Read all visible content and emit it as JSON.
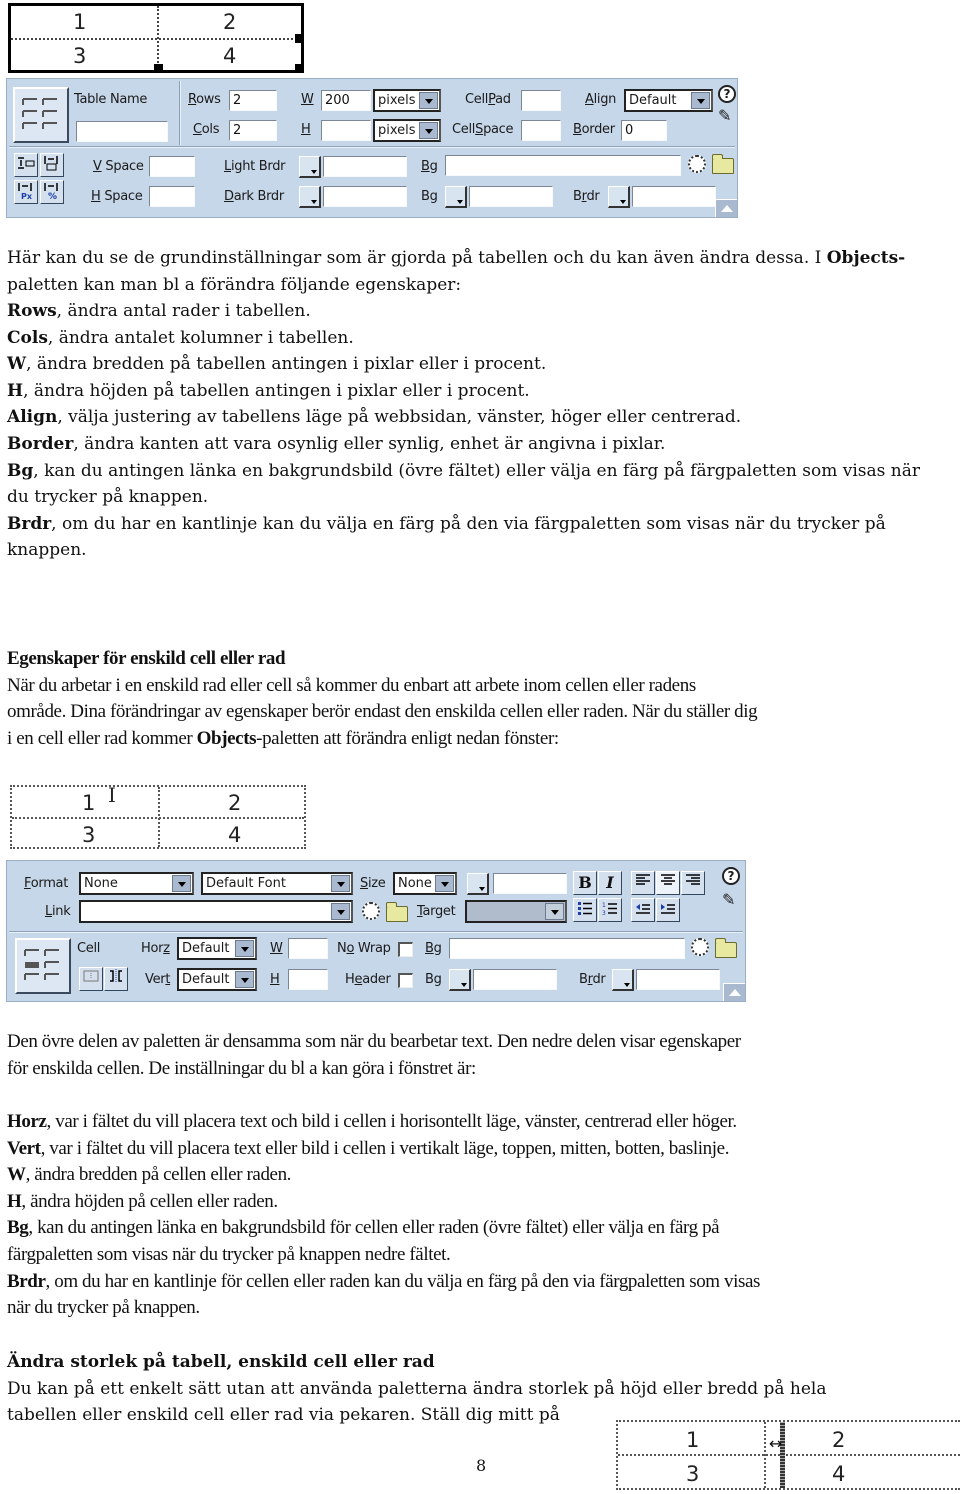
{
  "table_diagram_1": {
    "cells": [
      "1",
      "2",
      "3",
      "4"
    ]
  },
  "table_palette": {
    "table_name_label": "Table Name",
    "table_name_value": "",
    "rows_label": "Rows",
    "rows_value": "2",
    "cols_label": "Cols",
    "cols_value": "2",
    "w_label": "W",
    "w_value": "200",
    "w_unit": "pixels",
    "h_label": "H",
    "h_value": "",
    "h_unit": "pixels",
    "cellpad_label": "CellPad",
    "cellpad_value": "",
    "cellspace_label": "CellSpace",
    "cellspace_value": "",
    "align_label": "Align",
    "align_value": "Default",
    "border_label": "Border",
    "border_value": "0",
    "vspace_label": "V Space",
    "vspace_value": "",
    "hspace_label": "H Space",
    "hspace_value": "",
    "light_brdr_label": "Light Brdr",
    "light_brdr_value": "",
    "dark_brdr_label": "Dark Brdr",
    "dark_brdr_value": "",
    "bg_image_label": "Bg",
    "bg_image_value": "",
    "bg_color_label": "Bg",
    "bg_color_value": "",
    "brdr_label": "Brdr",
    "brdr_value": "",
    "help_glyph": "?",
    "icons": [
      "table-icon",
      "clear-row-heights-icon",
      "clear-col-widths-icon",
      "convert-widths-to-pixels-icon",
      "convert-widths-to-percent-icon",
      "help-icon",
      "quick-tag-editor-icon",
      "point-to-file-icon",
      "folder-icon",
      "collapse-icon"
    ]
  },
  "section1": {
    "intro_line1_prefix": "Här kan du se de grundinställningar som är gjorda på tabellen och du kan även ändra dessa. I ",
    "intro_line1_bold": "Objects-",
    "intro_line2": "paletten kan man bl a förändra följande egenskaper:",
    "items": [
      {
        "term": "Rows",
        "desc": ", ändra antal rader i tabellen."
      },
      {
        "term": "Cols",
        "desc": ", ändra antalet kolumner i tabellen."
      },
      {
        "term": "W",
        "desc": ", ändra bredden på tabellen antingen i pixlar eller i procent."
      },
      {
        "term": "H",
        "desc": ", ändra höjden på tabellen antingen i pixlar eller i procent."
      },
      {
        "term": "Align",
        "desc": ", välja justering av tabellens läge på webbsidan, vänster, höger eller centrerad."
      },
      {
        "term": "Border",
        "desc": ", ändra kanten att vara osynlig eller synlig, enhet är angivna i pixlar."
      },
      {
        "term": "Bg",
        "desc": ", kan du antingen länka en bakgrundsbild (övre fältet) eller välja en färg på färgpaletten som visas när",
        "desc2": "du trycker på knappen."
      },
      {
        "term": "Brdr",
        "desc": ", om du har en kantlinje kan du välja en färg på den via färgpaletten som visas när du trycker på",
        "desc2": "knappen."
      }
    ]
  },
  "section2": {
    "heading": "Egenskaper för enskild cell eller rad",
    "para_line1": "När du arbetar i en enskild rad eller cell så kommer du enbart att arbete inom cellen eller radens",
    "para_line2": "område. Dina förändringar av egenskaper berör endast den enskilda cellen eller raden. När du ställer dig",
    "para_line3_prefix": "i en cell eller rad kommer ",
    "para_line3_bold": "Objects",
    "para_line3_suffix": "-paletten att förändra enligt nedan fönster:"
  },
  "table_diagram_2": {
    "cells": [
      "1",
      "2",
      "3",
      "4"
    ],
    "cursor": "I"
  },
  "cell_palette": {
    "format_label": "Format",
    "format_value": "None",
    "font_value": "Default Font",
    "size_label": "Size",
    "size_value": "None",
    "text_color_value": "",
    "bold_label": "B",
    "italic_label": "I",
    "link_label": "Link",
    "link_value": "",
    "target_label": "Target",
    "target_value": "",
    "cell_label": "Cell",
    "horz_label": "Horz",
    "horz_value": "Default",
    "vert_label": "Vert",
    "vert_value": "Default",
    "w_label": "W",
    "w_value": "",
    "h_label": "H",
    "h_value": "",
    "nowrap_label": "No Wrap",
    "nowrap_checked": false,
    "header_label": "Header",
    "header_checked": false,
    "bg_image_label": "Bg",
    "bg_image_value": "",
    "bg_color_label": "Bg",
    "bg_color_value": "",
    "brdr_label": "Brdr",
    "brdr_value": "",
    "help_glyph": "?"
  },
  "section3": {
    "para_line1": "Den övre delen av paletten är densamma som när du bearbetar text. Den nedre delen visar egenskaper",
    "para_line2": "för enskilda cellen. De inställningar du bl a kan göra i fönstret är:",
    "items": [
      {
        "term": "Horz",
        "desc": ", var i fältet du vill placera text och bild i cellen i horisontellt läge, vänster, centrerad eller höger."
      },
      {
        "term": "Vert",
        "desc": ", var i fältet du vill placera text eller bild i cellen i vertikalt läge, toppen, mitten, botten, baslinje."
      },
      {
        "term": "W",
        "desc": ", ändra bredden på cellen eller raden."
      },
      {
        "term": "H",
        "desc": ", ändra höjden på cellen eller raden."
      },
      {
        "term": "Bg",
        "desc": ", kan du antingen länka en bakgrundsbild för cellen eller raden (övre fältet) eller välja en färg på",
        "desc2": "färgpaletten som visas när du trycker på knappen nedre fältet."
      },
      {
        "term": "Brdr",
        "desc": ", om du har en kantlinje för cellen eller raden kan du välja en färg på den via färgpaletten som visas",
        "desc2": "när du trycker på knappen."
      }
    ]
  },
  "section4": {
    "heading": "Ändra storlek på tabell, enskild cell eller rad",
    "para_line1": "Du kan på ett enkelt sätt utan att använda paletterna ändra storlek på höjd eller bredd på hela",
    "para_line2": "tabellen eller enskild cell eller rad via pekaren. Ställ dig mitt på"
  },
  "table_diagram_3": {
    "cells": [
      "1",
      "2",
      "3",
      "4"
    ]
  },
  "page_number": "8"
}
